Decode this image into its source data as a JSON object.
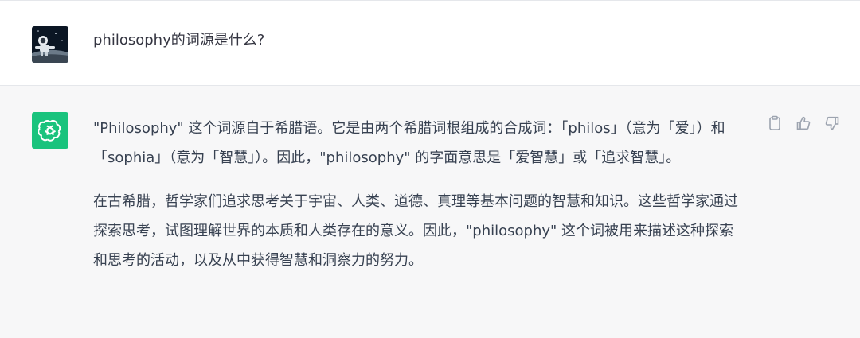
{
  "user_message": {
    "text": "philosophy的词源是什么?"
  },
  "assistant_message": {
    "paragraphs": [
      "\"Philosophy\" 这个词源自于希腊语。它是由两个希腊词根组成的合成词：「philos」（意为「爱」）和「sophia」（意为「智慧」）。因此，\"philosophy\" 的字面意思是「爱智慧」或「追求智慧」。",
      "在古希腊，哲学家们追求思考关于宇宙、人类、道德、真理等基本问题的智慧和知识。这些哲学家通过探索思考，试图理解世界的本质和人类存在的意义。因此，\"philosophy\" 这个词被用来描述这种探索和思考的活动，以及从中获得智慧和洞察力的努力。"
    ]
  },
  "icons": {
    "copy": "clipboard-icon",
    "like": "thumbs-up-icon",
    "dislike": "thumbs-down-icon",
    "assistant_logo": "openai-logo-icon"
  },
  "colors": {
    "assistant_avatar": "#19c37d",
    "assistant_row_bg": "#f7f7f8",
    "text": "#374151"
  }
}
